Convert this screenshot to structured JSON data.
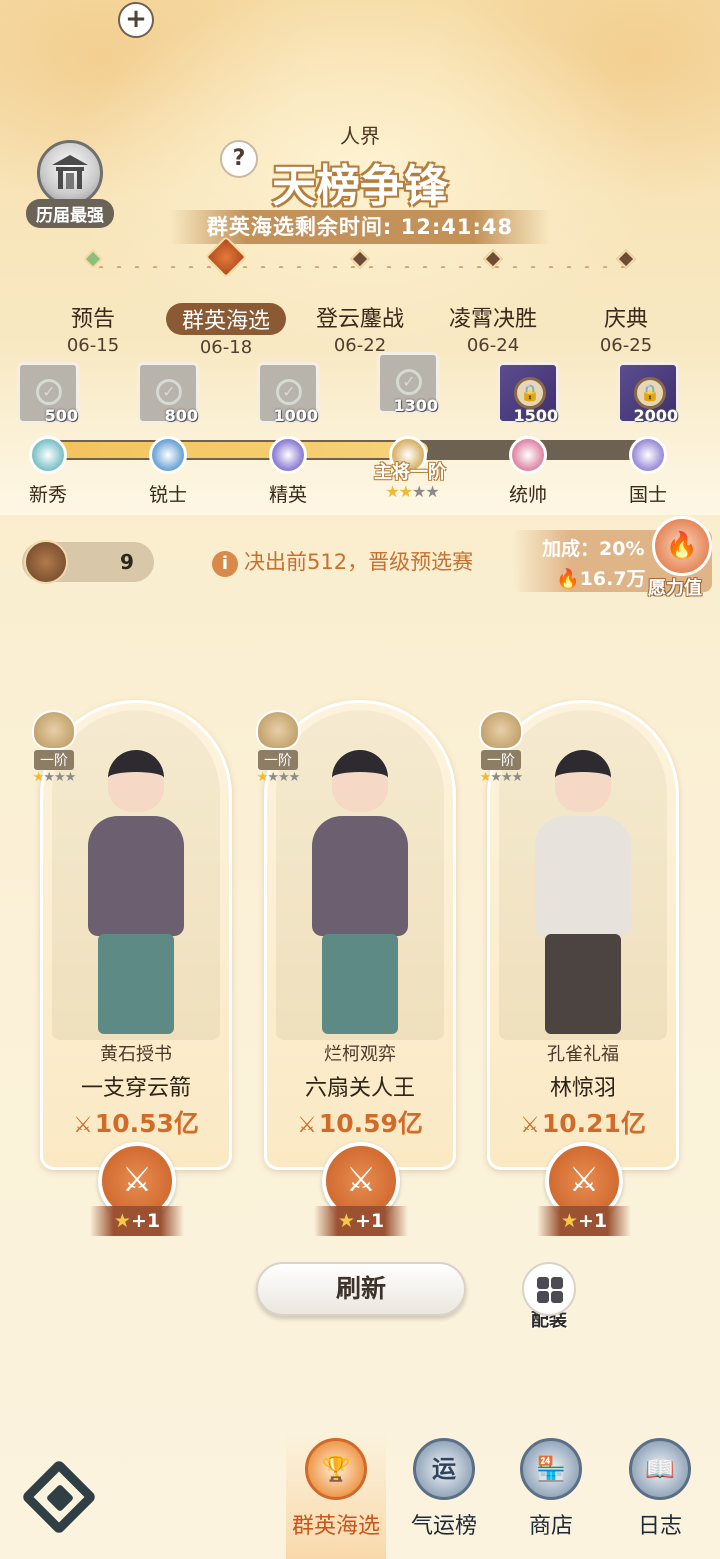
{
  "header": {
    "hall_of_fame_label": "历届最强",
    "help_icon": "?",
    "realm": "人界",
    "title": "天榜争锋",
    "countdown_label": "群英海选剩余时间:",
    "countdown_value": "12:41:48"
  },
  "stages": [
    {
      "name": "预告",
      "date": "06-15",
      "state": "done"
    },
    {
      "name": "群英海选",
      "date": "06-18",
      "state": "active"
    },
    {
      "name": "登云鏖战",
      "date": "06-22",
      "state": "upcoming"
    },
    {
      "name": "凌霄决胜",
      "date": "06-24",
      "state": "upcoming"
    },
    {
      "name": "庆典",
      "date": "06-25",
      "state": "upcoming"
    }
  ],
  "ranks": {
    "progress_fraction": 0.62,
    "tiers": [
      {
        "name": "新秀",
        "reward": "500",
        "status": "claimed",
        "color": "#7fc3c9"
      },
      {
        "name": "锐士",
        "reward": "800",
        "status": "claimed",
        "color": "#6fa6d6"
      },
      {
        "name": "精英",
        "reward": "1000",
        "status": "claimed",
        "color": "#8f7fd6"
      },
      {
        "name": "主将一阶",
        "reward": "1300",
        "status": "current",
        "color": "#d9b36a"
      },
      {
        "name": "统帅",
        "reward": "1500",
        "status": "locked",
        "color": "#e08aa8"
      },
      {
        "name": "国士",
        "reward": "2000",
        "status": "locked",
        "color": "#9d8fd9"
      }
    ],
    "current_stars": {
      "filled": 2,
      "total": 4
    }
  },
  "info_bar": {
    "tickets_count": "9",
    "plus_label": "+",
    "notice_icon": "i",
    "notice_text": "决出前512，晋级预选赛",
    "bonus_rate": "加成：20%",
    "bonus_value": "16.7万",
    "wish_label": "愿力值"
  },
  "opponents": [
    {
      "title": "黄石授书",
      "name": "一支穿云箭",
      "power": "10.53亿",
      "rank": "一阶",
      "stars_filled": 1,
      "stars_total": 4,
      "fight_bonus": "+1",
      "style": "a"
    },
    {
      "title": "烂柯观弈",
      "name": "六扇关人王",
      "power": "10.59亿",
      "rank": "一阶",
      "stars_filled": 1,
      "stars_total": 4,
      "fight_bonus": "+1",
      "style": "a"
    },
    {
      "title": "孔雀礼福",
      "name": "林惊羽",
      "power": "10.21亿",
      "rank": "一阶",
      "stars_filled": 1,
      "stars_total": 4,
      "fight_bonus": "+1",
      "style": "b"
    }
  ],
  "actions": {
    "refresh_label": "刷新",
    "equip_label": "配装"
  },
  "bottom_nav": [
    {
      "label": "群英海选",
      "icon": "trophy-icon",
      "active": true
    },
    {
      "label": "气运榜",
      "icon": "fortune-icon",
      "glyph": "运",
      "active": false
    },
    {
      "label": "商店",
      "icon": "shop-icon",
      "active": false
    },
    {
      "label": "日志",
      "icon": "log-icon",
      "active": false
    }
  ],
  "colors": {
    "accent_orange": "#d26a2a",
    "active_nav": "#c9541c",
    "bar_fill": "#f3c35b"
  }
}
